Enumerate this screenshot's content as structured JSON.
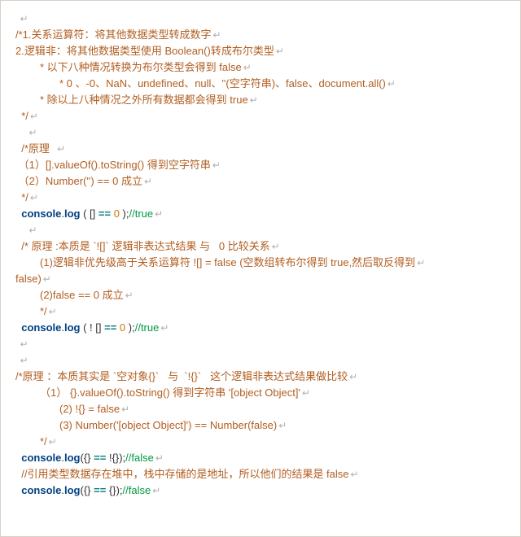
{
  "lines": [
    {
      "cls": "",
      "spans": [
        {
          "c": "",
          "t": " "
        }
      ]
    },
    {
      "cls": "",
      "spans": [
        {
          "c": "cmt",
          "t": "/*1.关系运算符：将其他数据类型转成数字"
        }
      ]
    },
    {
      "cls": "",
      "spans": [
        {
          "c": "cmt",
          "t": "2.逻辑非：将其他数据类型使用 Boolean()转成布尔类型"
        }
      ]
    },
    {
      "cls": "ind1",
      "spans": [
        {
          "c": "cmt",
          "t": "* 以下八种情况转换为布尔类型会得到 false"
        }
      ]
    },
    {
      "cls": "ind2",
      "spans": [
        {
          "c": "cmt",
          "t": "* 0 、-0、NaN、undefined、null、''(空字符串)、false、document.all()"
        }
      ]
    },
    {
      "cls": "ind1",
      "spans": [
        {
          "c": "cmt",
          "t": "* 除以上八种情况之外所有数据都会得到 true"
        }
      ]
    },
    {
      "cls": "",
      "spans": [
        {
          "c": "cmt",
          "t": "  */"
        }
      ]
    },
    {
      "cls": "",
      "spans": [
        {
          "c": "",
          "t": "    "
        }
      ]
    },
    {
      "cls": "",
      "spans": [
        {
          "c": "cmt",
          "t": "  /*原理"
        },
        {
          "c": "",
          "t": "  "
        }
      ]
    },
    {
      "cls": "",
      "spans": [
        {
          "c": "cmt",
          "t": " （1）[].valueOf().toString() 得到空字符串"
        }
      ]
    },
    {
      "cls": "",
      "spans": [
        {
          "c": "cmt",
          "t": " （2）Number('') == 0 成立"
        }
      ]
    },
    {
      "cls": "",
      "spans": [
        {
          "c": "cmt",
          "t": "  */"
        }
      ]
    },
    {
      "cls": "",
      "spans": [
        {
          "c": "",
          "t": "  "
        },
        {
          "c": "id",
          "t": "console"
        },
        {
          "c": "",
          "t": "."
        },
        {
          "c": "id",
          "t": "log"
        },
        {
          "c": "",
          "t": " ( [] "
        },
        {
          "c": "op",
          "t": "=="
        },
        {
          "c": "",
          "t": " "
        },
        {
          "c": "num",
          "t": "0"
        },
        {
          "c": "",
          "t": " );"
        },
        {
          "c": "green",
          "t": "//true"
        }
      ]
    },
    {
      "cls": "",
      "spans": [
        {
          "c": "",
          "t": "    "
        }
      ]
    },
    {
      "cls": "",
      "spans": [
        {
          "c": "cmt",
          "t": "  /* 原理 :本质是 `![]` 逻辑非表达式结果 与   0 比较关系"
        }
      ]
    },
    {
      "cls": "ind1",
      "spans": [
        {
          "c": "cmt",
          "t": "(1)逻辑非优先级高于关系运算符 ![] = false (空数组转布尔得到 true,然后取反得到"
        }
      ]
    },
    {
      "cls": "",
      "spans": [
        {
          "c": "cmt",
          "t": "false)"
        }
      ]
    },
    {
      "cls": "ind1",
      "spans": [
        {
          "c": "cmt",
          "t": "(2)false == 0 成立"
        }
      ]
    },
    {
      "cls": "ind1",
      "spans": [
        {
          "c": "cmt",
          "t": "*/"
        }
      ]
    },
    {
      "cls": "",
      "spans": [
        {
          "c": "",
          "t": "  "
        },
        {
          "c": "id",
          "t": "console"
        },
        {
          "c": "",
          "t": "."
        },
        {
          "c": "id",
          "t": "log"
        },
        {
          "c": "",
          "t": " ( ! [] "
        },
        {
          "c": "op",
          "t": "=="
        },
        {
          "c": "",
          "t": " "
        },
        {
          "c": "num",
          "t": "0"
        },
        {
          "c": "",
          "t": " );"
        },
        {
          "c": "green",
          "t": "//true"
        }
      ]
    },
    {
      "cls": "",
      "spans": [
        {
          "c": "",
          "t": " "
        }
      ]
    },
    {
      "cls": "",
      "spans": [
        {
          "c": "",
          "t": " "
        }
      ]
    },
    {
      "cls": "",
      "spans": [
        {
          "c": "cmt",
          "t": "/*原理 ：本质其实是 `空对象{}`   与  `!{}`   这个逻辑非表达式结果做比较"
        }
      ]
    },
    {
      "cls": "ind1",
      "spans": [
        {
          "c": "cmt",
          "t": "（1） {}.valueOf().toString() 得到字符串 '[object Object]'"
        }
      ]
    },
    {
      "cls": "ind2",
      "spans": [
        {
          "c": "cmt",
          "t": "(2) !{} = false"
        }
      ]
    },
    {
      "cls": "ind2",
      "spans": [
        {
          "c": "cmt",
          "t": "(3) Number('[object Object]') == Number(false)"
        }
      ]
    },
    {
      "cls": "ind1",
      "spans": [
        {
          "c": "cmt",
          "t": "*/"
        }
      ]
    },
    {
      "cls": "",
      "spans": [
        {
          "c": "",
          "t": "  "
        },
        {
          "c": "id",
          "t": "console"
        },
        {
          "c": "",
          "t": "."
        },
        {
          "c": "id",
          "t": "log"
        },
        {
          "c": "",
          "t": "({} "
        },
        {
          "c": "op",
          "t": "=="
        },
        {
          "c": "",
          "t": " !{});"
        },
        {
          "c": "green",
          "t": "//false"
        }
      ]
    },
    {
      "cls": "",
      "spans": [
        {
          "c": "cmt",
          "t": "  //引用类型数据存在堆中，栈中存储的是地址，所以他们的结果是 false"
        }
      ]
    },
    {
      "cls": "",
      "spans": [
        {
          "c": "",
          "t": "  "
        },
        {
          "c": "id",
          "t": "console"
        },
        {
          "c": "",
          "t": "."
        },
        {
          "c": "id",
          "t": "log"
        },
        {
          "c": "",
          "t": "({} "
        },
        {
          "c": "op",
          "t": "=="
        },
        {
          "c": "",
          "t": " {});"
        },
        {
          "c": "green",
          "t": "//false"
        }
      ]
    }
  ]
}
